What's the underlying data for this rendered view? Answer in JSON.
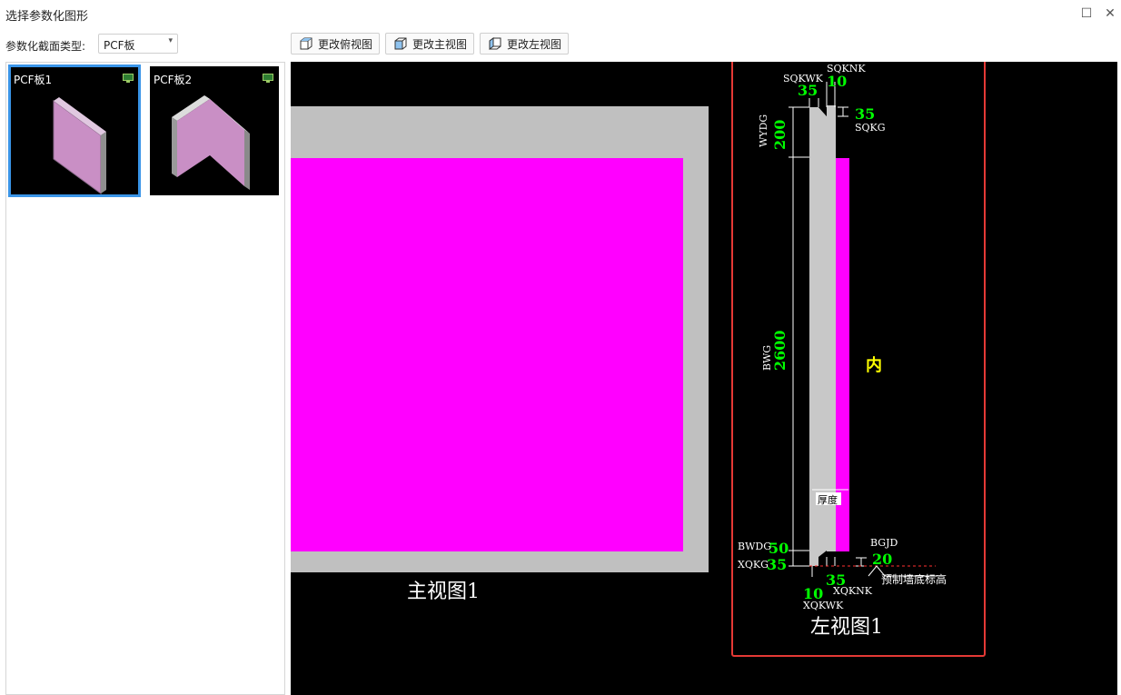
{
  "window": {
    "title": "选择参数化图形",
    "maximize_glyph": "☐",
    "close_glyph": "✕"
  },
  "toolbar": {
    "section_type_label": "参数化截面类型:",
    "section_type_value": "PCF板",
    "buttons": [
      {
        "label": "更改俯视图",
        "icon": "cube-top-icon"
      },
      {
        "label": "更改主视图",
        "icon": "cube-front-icon"
      },
      {
        "label": "更改左视图",
        "icon": "cube-left-icon"
      }
    ]
  },
  "thumbnails": [
    {
      "label": "PCF板1",
      "selected": true
    },
    {
      "label": "PCF板2",
      "selected": false
    }
  ],
  "front_view": {
    "caption": "主视图1"
  },
  "left_view": {
    "caption": "左视图1",
    "inner_label": "内",
    "dims": {
      "sqkwk": {
        "name": "SQKWK",
        "value": "35"
      },
      "sqknk": {
        "name": "SQKNK",
        "value": "10"
      },
      "sqkg": {
        "name": "SQKG",
        "value": "35"
      },
      "wydg": {
        "name": "WYDG",
        "value": "200"
      },
      "bwg": {
        "name": "BWG",
        "value": "2600"
      },
      "thickness": {
        "name": "厚度"
      },
      "bwdg": {
        "name": "BWDG",
        "value": "50"
      },
      "xqkg": {
        "name": "XQKG",
        "value": "35"
      },
      "bgjd": {
        "name": "BGJD",
        "value": "20"
      },
      "xqknk": {
        "name": "XQKNK",
        "value": "35"
      },
      "xqkwk": {
        "name": "XQKWK",
        "value": "10"
      },
      "base_elev": {
        "name": "预制墙底标高"
      }
    }
  },
  "colors": {
    "accent": "#3a95e8",
    "magenta": "#ff00ff",
    "dim_value": "#00ff00",
    "highlight_box": "#e53935",
    "inner_label": "#ffff00"
  }
}
